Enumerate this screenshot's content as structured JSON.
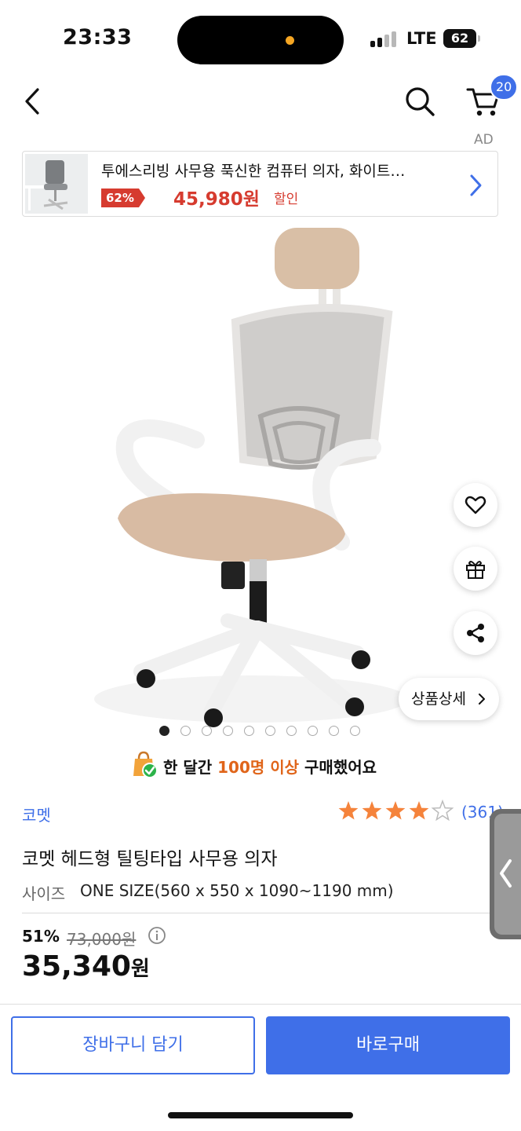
{
  "status_bar": {
    "time": "23:33",
    "network": "LTE",
    "battery": "62"
  },
  "nav": {
    "cart_count": "20",
    "ad_label": "AD"
  },
  "ad_banner": {
    "title": "투에스리빙 사무용 푹신한 컴퓨터 의자, 화이트…",
    "discount": "62%",
    "price": "45,980원",
    "sale_text": "할인"
  },
  "gallery": {
    "image_count": 10,
    "active_index": 0,
    "detail_button": "상품상세"
  },
  "purchase_note": {
    "prefix": "한 달간 ",
    "highlight": "100명 이상",
    "suffix": " 구매했어요"
  },
  "product": {
    "brand": "코멧",
    "rating": 4,
    "rating_max": 5,
    "review_count": "(361)",
    "title": "코멧 헤드형 틸팅타입 사무용 의자",
    "size_label": "사이즈",
    "size_value": "ONE SIZE(560 x 550 x 1090~1190 mm)",
    "discount_pct": "51%",
    "original_price": "73,000원",
    "sale_price": "35,340",
    "currency": "원"
  },
  "actions": {
    "add_to_cart": "장바구니 담기",
    "buy_now": "바로구매"
  },
  "colors": {
    "accent": "#3f6fe8",
    "sale_red": "#d63b2f",
    "star": "#f5833b",
    "highlight_orange": "#e0651a"
  },
  "icons": {
    "back": "chevron-left-icon",
    "search": "search-icon",
    "cart": "cart-icon",
    "wishlist": "heart-icon",
    "gift": "gift-icon",
    "share": "share-icon"
  }
}
